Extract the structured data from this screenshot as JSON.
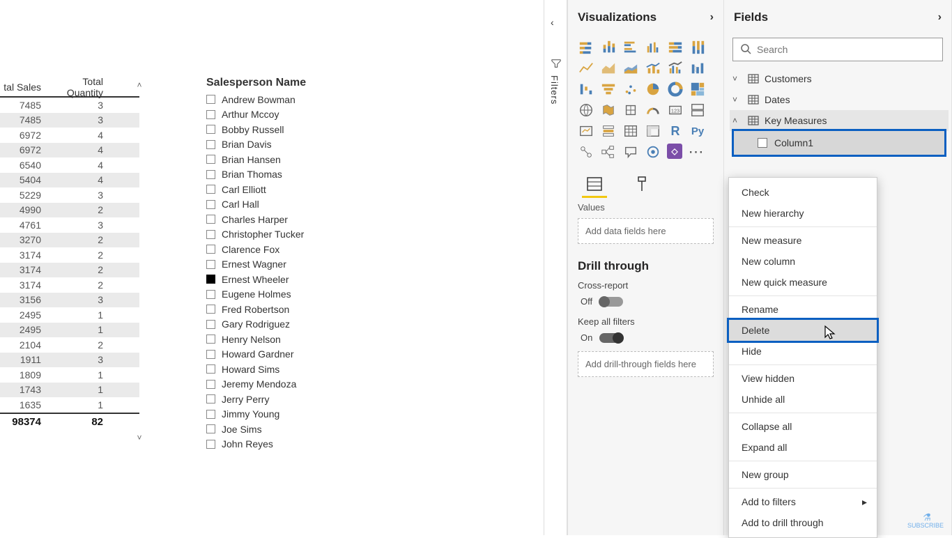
{
  "report": {
    "table": {
      "headers": {
        "col1": "tal Sales",
        "col2": "Total Quantity"
      },
      "rows": [
        {
          "sales": "7485",
          "qty": "3"
        },
        {
          "sales": "7485",
          "qty": "3"
        },
        {
          "sales": "6972",
          "qty": "4"
        },
        {
          "sales": "6972",
          "qty": "4"
        },
        {
          "sales": "6540",
          "qty": "4"
        },
        {
          "sales": "5404",
          "qty": "4"
        },
        {
          "sales": "5229",
          "qty": "3"
        },
        {
          "sales": "4990",
          "qty": "2"
        },
        {
          "sales": "4761",
          "qty": "3"
        },
        {
          "sales": "3270",
          "qty": "2"
        },
        {
          "sales": "3174",
          "qty": "2"
        },
        {
          "sales": "3174",
          "qty": "2"
        },
        {
          "sales": "3174",
          "qty": "2"
        },
        {
          "sales": "3156",
          "qty": "3"
        },
        {
          "sales": "2495",
          "qty": "1"
        },
        {
          "sales": "2495",
          "qty": "1"
        },
        {
          "sales": "2104",
          "qty": "2"
        },
        {
          "sales": "1911",
          "qty": "3"
        },
        {
          "sales": "1809",
          "qty": "1"
        },
        {
          "sales": "1743",
          "qty": "1"
        },
        {
          "sales": "1635",
          "qty": "1"
        }
      ],
      "totals": {
        "sales": "98374",
        "qty": "82"
      }
    },
    "slicer": {
      "title": "Salesperson Name",
      "items": [
        {
          "label": "Andrew Bowman",
          "checked": false
        },
        {
          "label": "Arthur Mccoy",
          "checked": false
        },
        {
          "label": "Bobby Russell",
          "checked": false
        },
        {
          "label": "Brian Davis",
          "checked": false
        },
        {
          "label": "Brian Hansen",
          "checked": false
        },
        {
          "label": "Brian Thomas",
          "checked": false
        },
        {
          "label": "Carl Elliott",
          "checked": false
        },
        {
          "label": "Carl Hall",
          "checked": false
        },
        {
          "label": "Charles Harper",
          "checked": false
        },
        {
          "label": "Christopher Tucker",
          "checked": false
        },
        {
          "label": "Clarence Fox",
          "checked": false
        },
        {
          "label": "Ernest Wagner",
          "checked": false
        },
        {
          "label": "Ernest Wheeler",
          "checked": true
        },
        {
          "label": "Eugene Holmes",
          "checked": false
        },
        {
          "label": "Fred Robertson",
          "checked": false
        },
        {
          "label": "Gary Rodriguez",
          "checked": false
        },
        {
          "label": "Henry Nelson",
          "checked": false
        },
        {
          "label": "Howard Gardner",
          "checked": false
        },
        {
          "label": "Howard Sims",
          "checked": false
        },
        {
          "label": "Jeremy Mendoza",
          "checked": false
        },
        {
          "label": "Jerry Perry",
          "checked": false
        },
        {
          "label": "Jimmy Young",
          "checked": false
        },
        {
          "label": "Joe Sims",
          "checked": false
        },
        {
          "label": "John Reyes",
          "checked": false
        }
      ]
    }
  },
  "filters_pane": {
    "label": "Filters"
  },
  "vis_panel": {
    "title": "Visualizations",
    "values_label": "Values",
    "values_placeholder": "Add data fields here",
    "drill_title": "Drill through",
    "cross_report_label": "Cross-report",
    "cross_report_state": "Off",
    "keep_filters_label": "Keep all filters",
    "keep_filters_state": "On",
    "drill_placeholder": "Add drill-through fields here"
  },
  "fields_panel": {
    "title": "Fields",
    "search_placeholder": "Search",
    "tables": [
      {
        "name": "Customers",
        "expanded": false
      },
      {
        "name": "Dates",
        "expanded": false
      },
      {
        "name": "Key Measures",
        "expanded": true,
        "selected": true,
        "fields": [
          {
            "name": "Column1",
            "highlighted": true
          }
        ]
      }
    ]
  },
  "context_menu": {
    "items": [
      {
        "label": "Check"
      },
      {
        "label": "New hierarchy"
      },
      {
        "sep": true
      },
      {
        "label": "New measure"
      },
      {
        "label": "New column"
      },
      {
        "label": "New quick measure"
      },
      {
        "sep": true
      },
      {
        "label": "Rename"
      },
      {
        "label": "Delete",
        "hovered": true
      },
      {
        "label": "Hide"
      },
      {
        "sep": true
      },
      {
        "label": "View hidden"
      },
      {
        "label": "Unhide all"
      },
      {
        "sep": true
      },
      {
        "label": "Collapse all"
      },
      {
        "label": "Expand all"
      },
      {
        "sep": true
      },
      {
        "label": "New group"
      },
      {
        "sep": true
      },
      {
        "label": "Add to filters",
        "submenu": true
      },
      {
        "label": "Add to drill through"
      }
    ]
  },
  "watermark": "SUBSCRIBE"
}
